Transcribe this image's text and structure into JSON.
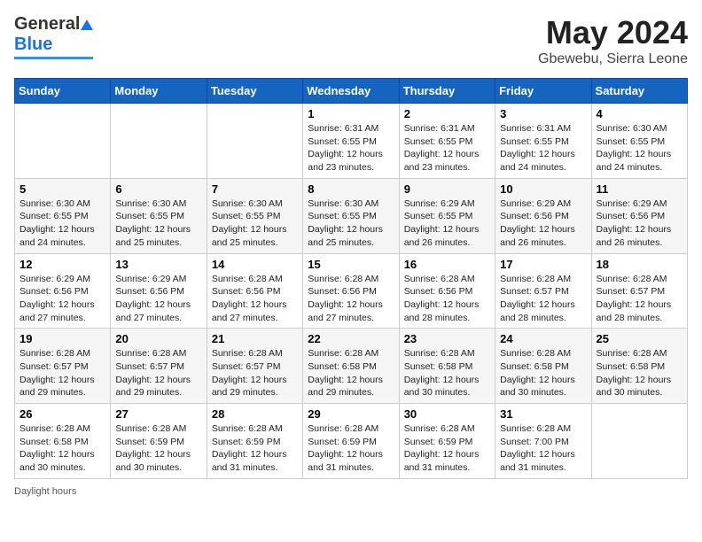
{
  "header": {
    "logo_general": "General",
    "logo_blue": "Blue",
    "title": "May 2024",
    "subtitle": "Gbewebu, Sierra Leone"
  },
  "calendar": {
    "days_of_week": [
      "Sunday",
      "Monday",
      "Tuesday",
      "Wednesday",
      "Thursday",
      "Friday",
      "Saturday"
    ],
    "weeks": [
      [
        {
          "day": "",
          "info": ""
        },
        {
          "day": "",
          "info": ""
        },
        {
          "day": "",
          "info": ""
        },
        {
          "day": "1",
          "info": "Sunrise: 6:31 AM\nSunset: 6:55 PM\nDaylight: 12 hours\nand 23 minutes."
        },
        {
          "day": "2",
          "info": "Sunrise: 6:31 AM\nSunset: 6:55 PM\nDaylight: 12 hours\nand 23 minutes."
        },
        {
          "day": "3",
          "info": "Sunrise: 6:31 AM\nSunset: 6:55 PM\nDaylight: 12 hours\nand 24 minutes."
        },
        {
          "day": "4",
          "info": "Sunrise: 6:30 AM\nSunset: 6:55 PM\nDaylight: 12 hours\nand 24 minutes."
        }
      ],
      [
        {
          "day": "5",
          "info": "Sunrise: 6:30 AM\nSunset: 6:55 PM\nDaylight: 12 hours\nand 24 minutes."
        },
        {
          "day": "6",
          "info": "Sunrise: 6:30 AM\nSunset: 6:55 PM\nDaylight: 12 hours\nand 25 minutes."
        },
        {
          "day": "7",
          "info": "Sunrise: 6:30 AM\nSunset: 6:55 PM\nDaylight: 12 hours\nand 25 minutes."
        },
        {
          "day": "8",
          "info": "Sunrise: 6:30 AM\nSunset: 6:55 PM\nDaylight: 12 hours\nand 25 minutes."
        },
        {
          "day": "9",
          "info": "Sunrise: 6:29 AM\nSunset: 6:55 PM\nDaylight: 12 hours\nand 26 minutes."
        },
        {
          "day": "10",
          "info": "Sunrise: 6:29 AM\nSunset: 6:56 PM\nDaylight: 12 hours\nand 26 minutes."
        },
        {
          "day": "11",
          "info": "Sunrise: 6:29 AM\nSunset: 6:56 PM\nDaylight: 12 hours\nand 26 minutes."
        }
      ],
      [
        {
          "day": "12",
          "info": "Sunrise: 6:29 AM\nSunset: 6:56 PM\nDaylight: 12 hours\nand 27 minutes."
        },
        {
          "day": "13",
          "info": "Sunrise: 6:29 AM\nSunset: 6:56 PM\nDaylight: 12 hours\nand 27 minutes."
        },
        {
          "day": "14",
          "info": "Sunrise: 6:28 AM\nSunset: 6:56 PM\nDaylight: 12 hours\nand 27 minutes."
        },
        {
          "day": "15",
          "info": "Sunrise: 6:28 AM\nSunset: 6:56 PM\nDaylight: 12 hours\nand 27 minutes."
        },
        {
          "day": "16",
          "info": "Sunrise: 6:28 AM\nSunset: 6:56 PM\nDaylight: 12 hours\nand 28 minutes."
        },
        {
          "day": "17",
          "info": "Sunrise: 6:28 AM\nSunset: 6:57 PM\nDaylight: 12 hours\nand 28 minutes."
        },
        {
          "day": "18",
          "info": "Sunrise: 6:28 AM\nSunset: 6:57 PM\nDaylight: 12 hours\nand 28 minutes."
        }
      ],
      [
        {
          "day": "19",
          "info": "Sunrise: 6:28 AM\nSunset: 6:57 PM\nDaylight: 12 hours\nand 29 minutes."
        },
        {
          "day": "20",
          "info": "Sunrise: 6:28 AM\nSunset: 6:57 PM\nDaylight: 12 hours\nand 29 minutes."
        },
        {
          "day": "21",
          "info": "Sunrise: 6:28 AM\nSunset: 6:57 PM\nDaylight: 12 hours\nand 29 minutes."
        },
        {
          "day": "22",
          "info": "Sunrise: 6:28 AM\nSunset: 6:58 PM\nDaylight: 12 hours\nand 29 minutes."
        },
        {
          "day": "23",
          "info": "Sunrise: 6:28 AM\nSunset: 6:58 PM\nDaylight: 12 hours\nand 30 minutes."
        },
        {
          "day": "24",
          "info": "Sunrise: 6:28 AM\nSunset: 6:58 PM\nDaylight: 12 hours\nand 30 minutes."
        },
        {
          "day": "25",
          "info": "Sunrise: 6:28 AM\nSunset: 6:58 PM\nDaylight: 12 hours\nand 30 minutes."
        }
      ],
      [
        {
          "day": "26",
          "info": "Sunrise: 6:28 AM\nSunset: 6:58 PM\nDaylight: 12 hours\nand 30 minutes."
        },
        {
          "day": "27",
          "info": "Sunrise: 6:28 AM\nSunset: 6:59 PM\nDaylight: 12 hours\nand 30 minutes."
        },
        {
          "day": "28",
          "info": "Sunrise: 6:28 AM\nSunset: 6:59 PM\nDaylight: 12 hours\nand 31 minutes."
        },
        {
          "day": "29",
          "info": "Sunrise: 6:28 AM\nSunset: 6:59 PM\nDaylight: 12 hours\nand 31 minutes."
        },
        {
          "day": "30",
          "info": "Sunrise: 6:28 AM\nSunset: 6:59 PM\nDaylight: 12 hours\nand 31 minutes."
        },
        {
          "day": "31",
          "info": "Sunrise: 6:28 AM\nSunset: 7:00 PM\nDaylight: 12 hours\nand 31 minutes."
        },
        {
          "day": "",
          "info": ""
        }
      ]
    ]
  },
  "footer": {
    "note": "Daylight hours"
  }
}
